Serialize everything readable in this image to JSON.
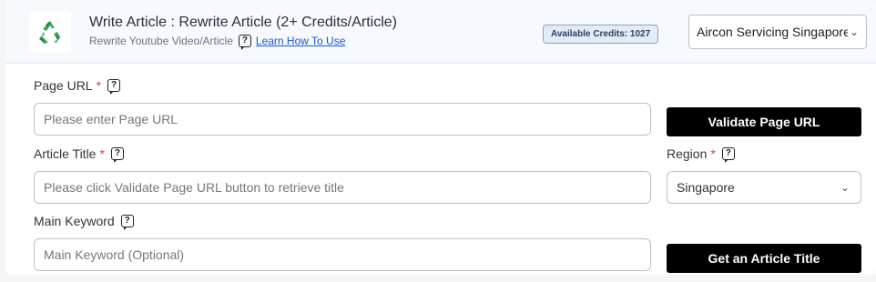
{
  "header": {
    "title": "Write Article : Rewrite Article (2+ Credits/Article)",
    "subtitle": "Rewrite Youtube Video/Article",
    "learn_link": "Learn How To Use",
    "credits": "Available Credits: 1027",
    "project_value": "Aircon Servicing Singapore"
  },
  "form": {
    "page_url": {
      "label": "Page URL",
      "required": "*",
      "placeholder": "Please enter Page URL"
    },
    "validate_button": "Validate Page URL",
    "article_title": {
      "label": "Article Title",
      "required": "*",
      "placeholder": "Please click Validate Page URL button to retrieve title"
    },
    "region": {
      "label": "Region",
      "required": "*",
      "value": "Singapore"
    },
    "main_keyword": {
      "label": "Main Keyword",
      "placeholder": "Main Keyword (Optional)"
    },
    "get_title_button": "Get an Article Title"
  },
  "icons": {
    "logo": "recycle-icon",
    "help": "help-question-icon",
    "dropdown": "chevron-down-icon"
  },
  "colors": {
    "accent_link": "#1a56db",
    "required": "#e53935",
    "button_bg": "#000000",
    "logo_green": "#3aa655"
  }
}
